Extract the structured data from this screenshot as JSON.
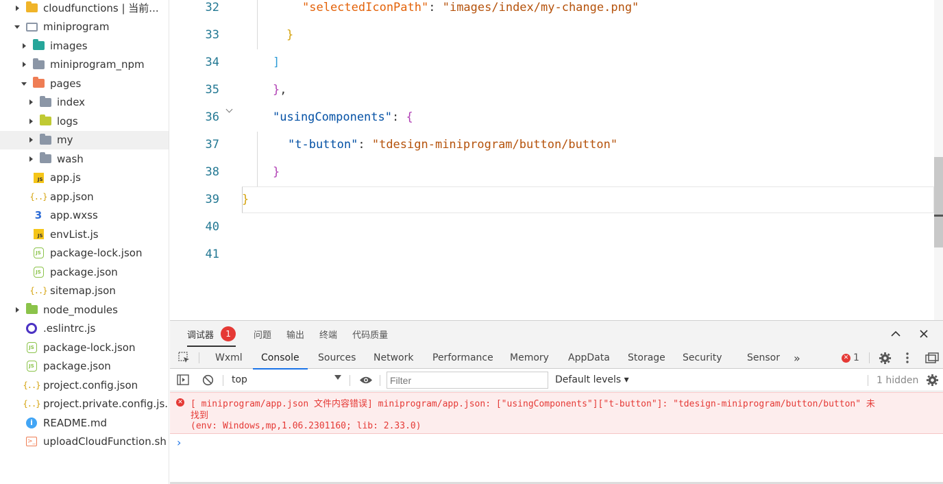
{
  "sidebar": {
    "items": [
      {
        "label": "cloudfunctions | 当前...",
        "state": "collapsed",
        "icon": "folder-icon-yellow",
        "depth": 0
      },
      {
        "label": "miniprogram",
        "state": "expanded",
        "icon": "folder-open-icon",
        "depth": 0
      },
      {
        "label": "images",
        "state": "collapsed",
        "icon": "folder-icon-teal",
        "depth": 1
      },
      {
        "label": "miniprogram_npm",
        "state": "collapsed",
        "icon": "folder-icon",
        "depth": 1
      },
      {
        "label": "pages",
        "state": "expanded",
        "icon": "folder-icon-orange",
        "depth": 1
      },
      {
        "label": "index",
        "state": "collapsed",
        "icon": "folder-icon",
        "depth": 2
      },
      {
        "label": "logs",
        "state": "collapsed",
        "icon": "folder-icon-lime",
        "depth": 2
      },
      {
        "label": "my",
        "state": "collapsed",
        "icon": "folder-icon",
        "depth": 2,
        "selected": true
      },
      {
        "label": "wash",
        "state": "collapsed",
        "icon": "folder-icon",
        "depth": 2
      },
      {
        "label": "app.js",
        "icon": "js-file-icon",
        "depth": 1
      },
      {
        "label": "app.json",
        "icon": "json-file-icon",
        "depth": 1
      },
      {
        "label": "app.wxss",
        "icon": "css-file-icon",
        "depth": 1
      },
      {
        "label": "envList.js",
        "icon": "js-file-icon",
        "depth": 1
      },
      {
        "label": "package-lock.json",
        "icon": "node-file-icon",
        "depth": 1
      },
      {
        "label": "package.json",
        "icon": "node-file-icon",
        "depth": 1
      },
      {
        "label": "sitemap.json",
        "icon": "json-file-icon",
        "depth": 1
      },
      {
        "label": "node_modules",
        "state": "collapsed",
        "icon": "folder-icon-green",
        "depth": 0
      },
      {
        "label": ".eslintrc.js",
        "icon": "eslint-file-icon",
        "depth": 0
      },
      {
        "label": "package-lock.json",
        "icon": "node-file-icon",
        "depth": 0
      },
      {
        "label": "package.json",
        "icon": "node-file-icon",
        "depth": 0
      },
      {
        "label": "project.config.json",
        "icon": "json-file-icon",
        "depth": 0
      },
      {
        "label": "project.private.config.js...",
        "icon": "json-file-icon",
        "depth": 0
      },
      {
        "label": "README.md",
        "icon": "info-file-icon",
        "depth": 0
      },
      {
        "label": "uploadCloudFunction.sh",
        "icon": "shell-file-icon",
        "depth": 0
      }
    ]
  },
  "editor": {
    "lines": [
      {
        "n": "32",
        "tokens": [
          {
            "t": "\"selectedIconPath\"",
            "c": "keyr"
          },
          {
            "t": ": ",
            "c": "punc"
          },
          {
            "t": "\"images/index/my-change.png\"",
            "c": "str"
          }
        ]
      },
      {
        "n": "33",
        "tokens": [
          {
            "t": "}",
            "c": "p1"
          }
        ]
      },
      {
        "n": "34",
        "tokens": [
          {
            "t": "]",
            "c": "p3"
          }
        ]
      },
      {
        "n": "35",
        "tokens": [
          {
            "t": "}",
            "c": "p2"
          },
          {
            "t": ",",
            "c": "punc"
          }
        ]
      },
      {
        "n": "36",
        "tokens": [
          {
            "t": "\"usingComponents\"",
            "c": "key"
          },
          {
            "t": ": ",
            "c": "punc"
          },
          {
            "t": "{",
            "c": "p2"
          }
        ]
      },
      {
        "n": "37",
        "tokens": [
          {
            "t": "\"t-button\"",
            "c": "key"
          },
          {
            "t": ": ",
            "c": "punc"
          },
          {
            "t": "\"tdesign-miniprogram/button/button\"",
            "c": "str"
          }
        ]
      },
      {
        "n": "38",
        "tokens": [
          {
            "t": "}",
            "c": "p2"
          }
        ]
      },
      {
        "n": "39",
        "tokens": [
          {
            "t": "}",
            "c": "p1"
          }
        ]
      },
      {
        "n": "40",
        "tokens": []
      },
      {
        "n": "41",
        "tokens": []
      }
    ]
  },
  "devtools": {
    "header_tabs": {
      "debugger": "调试器",
      "debugger_badge": "1",
      "issues": "问题",
      "output": "输出",
      "terminal": "终端",
      "code_quality": "代码质量"
    },
    "tabs": [
      "Wxml",
      "Console",
      "Sources",
      "Network",
      "Performance",
      "Memory",
      "AppData",
      "Storage",
      "Security",
      "Sensor"
    ],
    "active_tab": "Console",
    "more_tabs": "»",
    "error_count": "1",
    "context": "top",
    "filter_placeholder": "Filter",
    "levels": "Default levels ▾",
    "hidden": "1 hidden",
    "error": {
      "line1": "[ miniprogram/app.json 文件内容错误] miniprogram/app.json: [\"usingComponents\"][\"t-button\"]: \"tdesign-miniprogram/button/button\" 未",
      "line2": "找到",
      "line3": "(env: Windows,mp,1.06.2301160; lib: 2.33.0)"
    },
    "prompt": "›"
  }
}
